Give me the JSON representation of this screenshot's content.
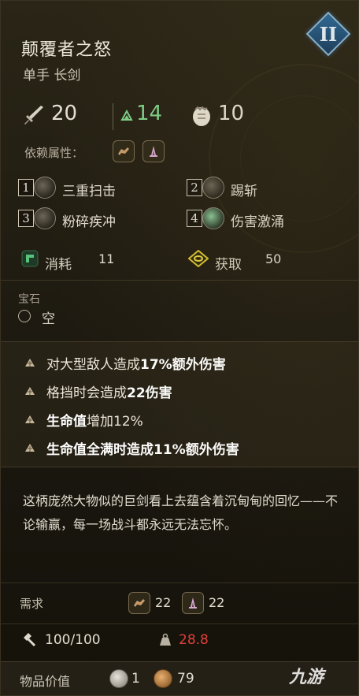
{
  "item": {
    "name": "颠覆者之怒",
    "type": "单手 长剑",
    "tier": "II"
  },
  "stats": {
    "damage": "20",
    "upgrade": "14",
    "stagger": "10"
  },
  "dependency_label": "依赖属性：",
  "skills": [
    {
      "num": "1",
      "name": "三重扫击"
    },
    {
      "num": "2",
      "name": "踢斩"
    },
    {
      "num": "3",
      "name": "粉碎疾冲"
    },
    {
      "num": "4",
      "name": "伤害激涌"
    }
  ],
  "consume": {
    "label": "消耗",
    "value": "11"
  },
  "gain": {
    "label": "获取",
    "value": "50"
  },
  "gem": {
    "title": "宝石",
    "value": "空"
  },
  "perks": [
    {
      "pre": "对大型敌人造成",
      "bold": "17%额外伤害",
      "post": ""
    },
    {
      "pre": "格挡时会造成",
      "bold": "22伤害",
      "post": ""
    },
    {
      "pre": "",
      "bold": "生命值",
      "post": "增加12%"
    },
    {
      "pre": "",
      "bold": "生命值全满时造成11%额外伤害",
      "post": ""
    }
  ],
  "lore": "这柄庞然大物似的巨剑看上去蕴含着沉甸甸的回忆——不论输赢，每一场战斗都永远无法忘怀。",
  "requirements": {
    "label": "需求",
    "strength": "22",
    "dexterity": "22"
  },
  "durability": "100/100",
  "weight": "28.8",
  "value": {
    "label": "物品价值",
    "silver": "1",
    "gold": "79"
  },
  "watermark": "九游",
  "colors": {
    "accent_blue": "#2b6a9a",
    "upgrade_green": "#7fd08a",
    "weight_red": "#e0403a"
  }
}
